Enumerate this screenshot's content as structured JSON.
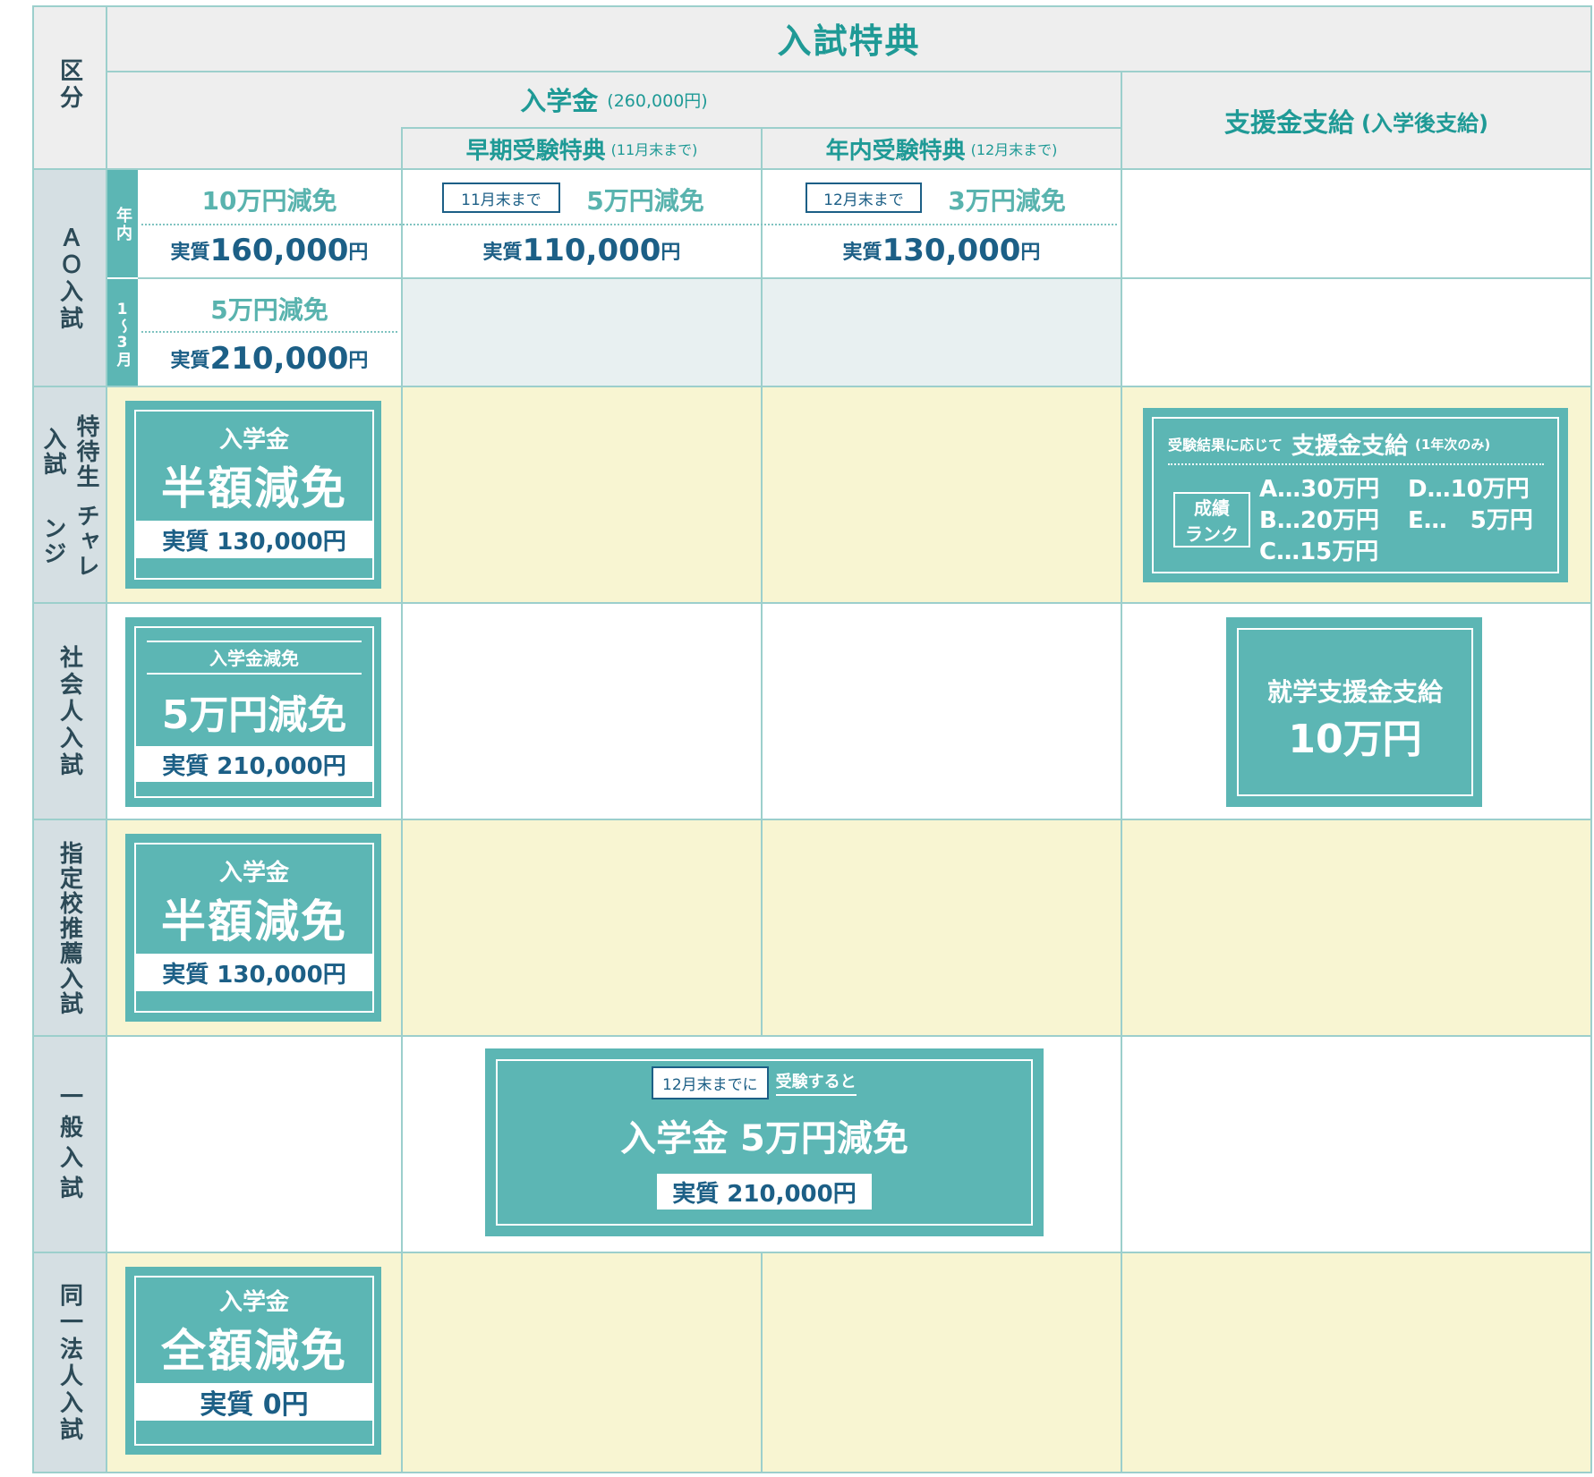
{
  "header": {
    "kubun": "区分",
    "title": "入試特典",
    "entrance_fee": "入学金",
    "entrance_fee_amount": "(260,000円)",
    "early_label": "早期受験特典",
    "early_note": "(11月末まで)",
    "year_label": "年内受験特典",
    "year_note": "(12月末まで)",
    "support_label": "支援金支給",
    "support_note": "(入学後支給)"
  },
  "ao": {
    "category": "ＡＯ入試",
    "row1_tag": "年内",
    "row2_tag": "1〜3月",
    "row1_discount": "10万円減免",
    "row1_jisshitsu": "実質",
    "row1_value": "160,000",
    "yen": "円",
    "early_tag": "11月末まで",
    "early_discount": "5万円減免",
    "early_value": "110,000",
    "year_tag": "12月末まで",
    "year_discount": "3万円減免",
    "year_value": "130,000",
    "row2_discount": "5万円減免",
    "row2_value": "210,000"
  },
  "challenge": {
    "category": "特待生入試\nチャレンジ",
    "cat_col1": "特待生入試",
    "cat_col2": "チャレンジ",
    "card_top": "入学金",
    "card_big": "半額減免",
    "card_band": "実質 130,000円",
    "support_lead": "受験結果に応じて",
    "support_title": "支援金支給",
    "support_note": "(1年次のみ)",
    "rank_label_1": "成績",
    "rank_label_2": "ランク",
    "ranks": [
      "A…30万円",
      "B…20万円",
      "C…15万円",
      "D…10万円",
      "E…　5万円"
    ]
  },
  "shakaijin": {
    "category": "社会人入試",
    "card_top": "入学金減免",
    "card_big": "5万円減免",
    "card_band": "実質 210,000円",
    "support_line1": "就学支援金支給",
    "support_line2": "10万円"
  },
  "shitei": {
    "category": "指定校推薦入試",
    "card_top": "入学金",
    "card_big": "半額減免",
    "card_band": "実質 130,000円"
  },
  "ippan": {
    "category": "一般入試",
    "tag": "12月末までに",
    "tag_after": "受験すると",
    "big": "入学金 5万円減免",
    "band": "実質 210,000円"
  },
  "douitsu": {
    "category": "同一法人入試",
    "card_top": "入学金",
    "card_big": "全額減免",
    "card_band": "実質 0円"
  }
}
